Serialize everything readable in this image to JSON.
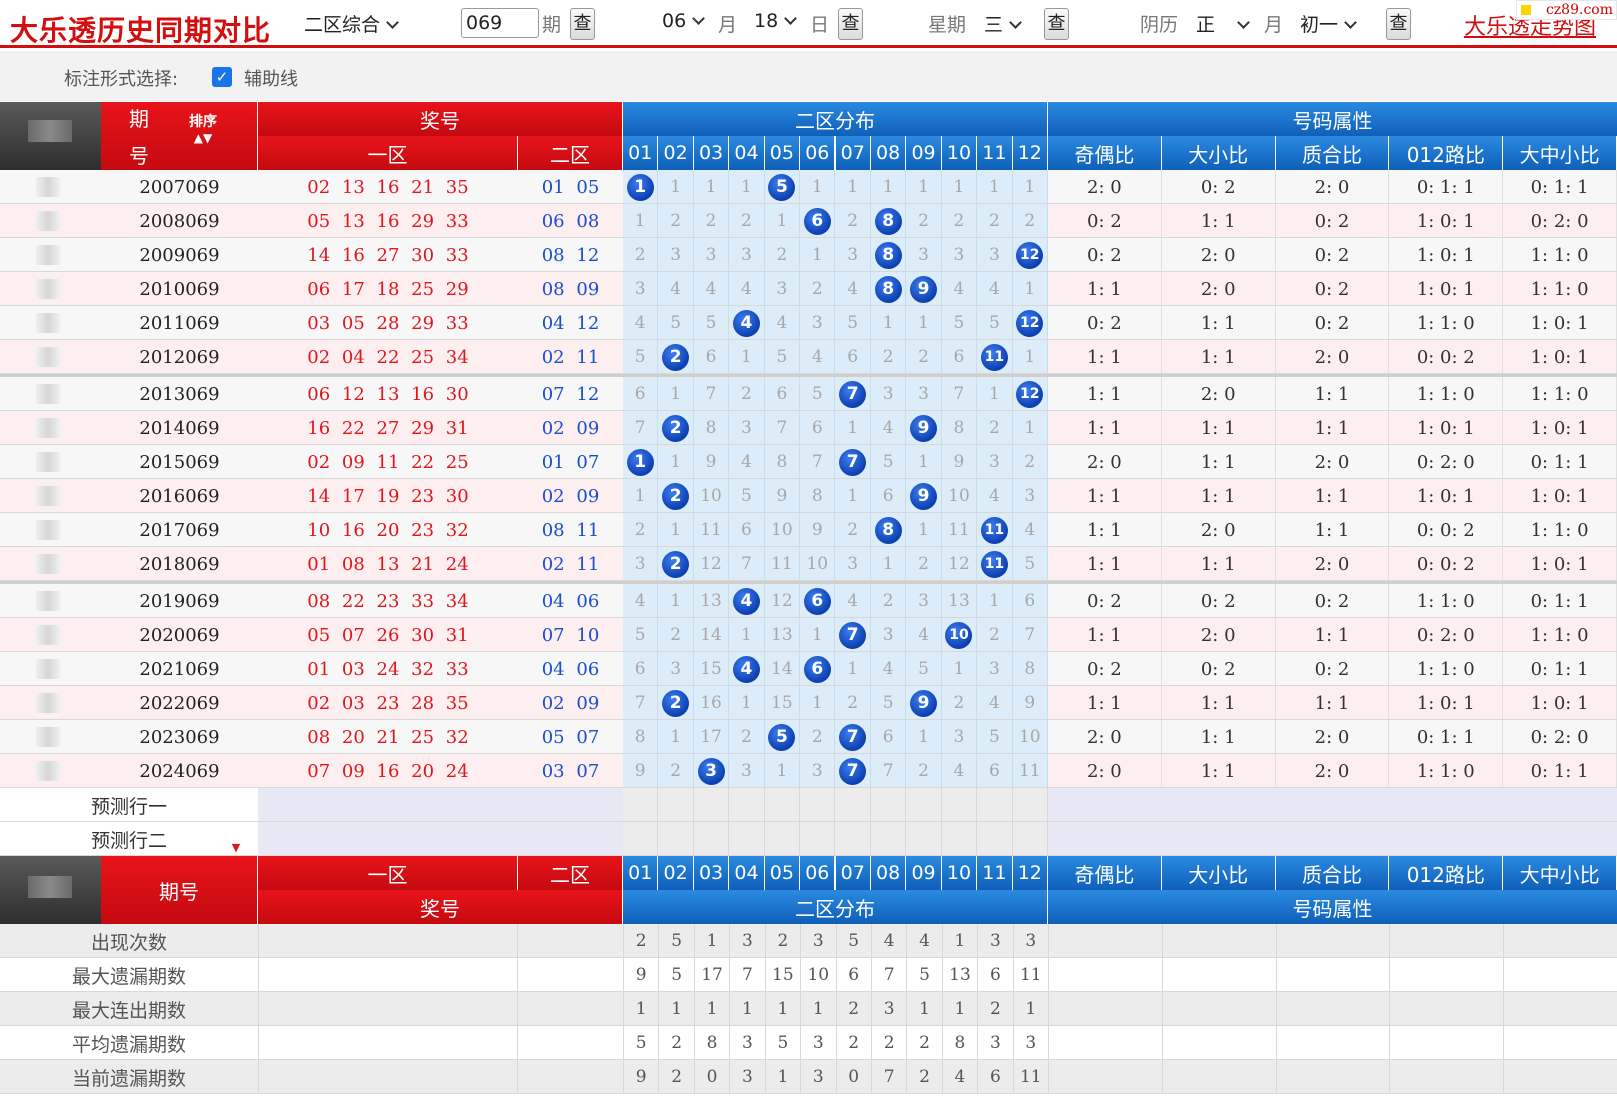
{
  "header": {
    "title": "大乐透历史同期对比",
    "mode_select": "二区综合",
    "issue_input": "069",
    "issue_suffix": "期",
    "query_label": "查",
    "month_select": "06",
    "month_suffix": "月",
    "day_select": "18",
    "day_suffix": "日",
    "weekday_label": "星期",
    "weekday_select": "三",
    "lunar_label": "阴历",
    "lunar_month_select": "正",
    "lunar_month_suffix": "月",
    "lunar_day_select": "初一",
    "trend_link": "大乐透走势图",
    "logo_text": "cz89.com"
  },
  "options": {
    "label": "标注形式选择:",
    "checkbox_label": "辅助线",
    "checkbox_checked": true
  },
  "table": {
    "col_period": "期号",
    "col_period_a": "期",
    "col_period_b": "号",
    "col_sort": "排序",
    "col_prize": "奖号",
    "col_zone1": "一区",
    "col_zone2": "二区",
    "col_dist": "二区分布",
    "col_attr": "号码属性",
    "numbers": [
      "01",
      "02",
      "03",
      "04",
      "05",
      "06",
      "07",
      "08",
      "09",
      "10",
      "11",
      "12"
    ],
    "attr_cols": [
      "奇偶比",
      "大小比",
      "质合比",
      "012路比",
      "大中小比"
    ],
    "rows": [
      {
        "period": "2007069",
        "zone1": "02 13 16 21 35",
        "zone2": "01 05",
        "dist": [
          "●1",
          "1",
          "1",
          "1",
          "●5",
          "1",
          "1",
          "1",
          "1",
          "1",
          "1",
          "1"
        ],
        "attrs": [
          "2: 0",
          "0: 2",
          "2: 0",
          "0: 1: 1",
          "0: 1: 1"
        ]
      },
      {
        "period": "2008069",
        "zone1": "05 13 16 29 33",
        "zone2": "06 08",
        "dist": [
          "1",
          "2",
          "2",
          "2",
          "1",
          "●6",
          "2",
          "●8",
          "2",
          "2",
          "2",
          "2"
        ],
        "attrs": [
          "0: 2",
          "1: 1",
          "0: 2",
          "1: 0: 1",
          "0: 2: 0"
        ]
      },
      {
        "period": "2009069",
        "zone1": "14 16 27 30 33",
        "zone2": "08 12",
        "dist": [
          "2",
          "3",
          "3",
          "3",
          "2",
          "1",
          "3",
          "●8",
          "3",
          "3",
          "3",
          "●12"
        ],
        "attrs": [
          "0: 2",
          "2: 0",
          "0: 2",
          "1: 0: 1",
          "1: 1: 0"
        ]
      },
      {
        "period": "2010069",
        "zone1": "06 17 18 25 29",
        "zone2": "08 09",
        "dist": [
          "3",
          "4",
          "4",
          "4",
          "3",
          "2",
          "4",
          "●8",
          "●9",
          "4",
          "4",
          "1"
        ],
        "attrs": [
          "1: 1",
          "2: 0",
          "0: 2",
          "1: 0: 1",
          "1: 1: 0"
        ]
      },
      {
        "period": "2011069",
        "zone1": "03 05 28 29 33",
        "zone2": "04 12",
        "dist": [
          "4",
          "5",
          "5",
          "●4",
          "4",
          "3",
          "5",
          "1",
          "1",
          "5",
          "5",
          "●12"
        ],
        "attrs": [
          "0: 2",
          "1: 1",
          "0: 2",
          "1: 1: 0",
          "1: 0: 1"
        ]
      },
      {
        "period": "2012069",
        "zone1": "02 04 22 25 34",
        "zone2": "02 11",
        "dist": [
          "5",
          "●2",
          "6",
          "1",
          "5",
          "4",
          "6",
          "2",
          "2",
          "6",
          "●11",
          "1"
        ],
        "attrs": [
          "1: 1",
          "1: 1",
          "2: 0",
          "0: 0: 2",
          "1: 0: 1"
        ]
      },
      {
        "period": "2013069",
        "zone1": "06 12 13 16 30",
        "zone2": "07 12",
        "dist": [
          "6",
          "1",
          "7",
          "2",
          "6",
          "5",
          "●7",
          "3",
          "3",
          "7",
          "1",
          "●12"
        ],
        "attrs": [
          "1: 1",
          "2: 0",
          "1: 1",
          "1: 1: 0",
          "1: 1: 0"
        ]
      },
      {
        "period": "2014069",
        "zone1": "16 22 27 29 31",
        "zone2": "02 09",
        "dist": [
          "7",
          "●2",
          "8",
          "3",
          "7",
          "6",
          "1",
          "4",
          "●9",
          "8",
          "2",
          "1"
        ],
        "attrs": [
          "1: 1",
          "1: 1",
          "1: 1",
          "1: 0: 1",
          "1: 0: 1"
        ]
      },
      {
        "period": "2015069",
        "zone1": "02 09 11 22 25",
        "zone2": "01 07",
        "dist": [
          "●1",
          "1",
          "9",
          "4",
          "8",
          "7",
          "●7",
          "5",
          "1",
          "9",
          "3",
          "2"
        ],
        "attrs": [
          "2: 0",
          "1: 1",
          "2: 0",
          "0: 2: 0",
          "0: 1: 1"
        ]
      },
      {
        "period": "2016069",
        "zone1": "14 17 19 23 30",
        "zone2": "02 09",
        "dist": [
          "1",
          "●2",
          "10",
          "5",
          "9",
          "8",
          "1",
          "6",
          "●9",
          "10",
          "4",
          "3"
        ],
        "attrs": [
          "1: 1",
          "1: 1",
          "1: 1",
          "1: 0: 1",
          "1: 0: 1"
        ]
      },
      {
        "period": "2017069",
        "zone1": "10 16 20 23 32",
        "zone2": "08 11",
        "dist": [
          "2",
          "1",
          "11",
          "6",
          "10",
          "9",
          "2",
          "●8",
          "1",
          "11",
          "●11",
          "4"
        ],
        "attrs": [
          "1: 1",
          "2: 0",
          "1: 1",
          "0: 0: 2",
          "1: 1: 0"
        ]
      },
      {
        "period": "2018069",
        "zone1": "01 08 13 21 24",
        "zone2": "02 11",
        "dist": [
          "3",
          "●2",
          "12",
          "7",
          "11",
          "10",
          "3",
          "1",
          "2",
          "12",
          "●11",
          "5"
        ],
        "attrs": [
          "1: 1",
          "1: 1",
          "2: 0",
          "0: 0: 2",
          "1: 0: 1"
        ]
      },
      {
        "period": "2019069",
        "zone1": "08 22 23 33 34",
        "zone2": "04 06",
        "dist": [
          "4",
          "1",
          "13",
          "●4",
          "12",
          "●6",
          "4",
          "2",
          "3",
          "13",
          "1",
          "6"
        ],
        "attrs": [
          "0: 2",
          "0: 2",
          "0: 2",
          "1: 1: 0",
          "0: 1: 1"
        ]
      },
      {
        "period": "2020069",
        "zone1": "05 07 26 30 31",
        "zone2": "07 10",
        "dist": [
          "5",
          "2",
          "14",
          "1",
          "13",
          "1",
          "●7",
          "3",
          "4",
          "●10",
          "2",
          "7"
        ],
        "attrs": [
          "1: 1",
          "2: 0",
          "1: 1",
          "0: 2: 0",
          "1: 1: 0"
        ]
      },
      {
        "period": "2021069",
        "zone1": "01 03 24 32 33",
        "zone2": "04 06",
        "dist": [
          "6",
          "3",
          "15",
          "●4",
          "14",
          "●6",
          "1",
          "4",
          "5",
          "1",
          "3",
          "8"
        ],
        "attrs": [
          "0: 2",
          "0: 2",
          "0: 2",
          "1: 1: 0",
          "0: 1: 1"
        ]
      },
      {
        "period": "2022069",
        "zone1": "02 03 23 28 35",
        "zone2": "02 09",
        "dist": [
          "7",
          "●2",
          "16",
          "1",
          "15",
          "1",
          "2",
          "5",
          "●9",
          "2",
          "4",
          "9"
        ],
        "attrs": [
          "1: 1",
          "1: 1",
          "1: 1",
          "1: 0: 1",
          "1: 0: 1"
        ]
      },
      {
        "period": "2023069",
        "zone1": "08 20 21 25 32",
        "zone2": "05 07",
        "dist": [
          "8",
          "1",
          "17",
          "2",
          "●5",
          "2",
          "●7",
          "6",
          "1",
          "3",
          "5",
          "10"
        ],
        "attrs": [
          "2: 0",
          "1: 1",
          "2: 0",
          "0: 1: 1",
          "0: 2: 0"
        ]
      },
      {
        "period": "2024069",
        "zone1": "07 09 16 20 24",
        "zone2": "03 07",
        "dist": [
          "9",
          "2",
          "●3",
          "3",
          "1",
          "3",
          "●7",
          "7",
          "2",
          "4",
          "6",
          "11"
        ],
        "attrs": [
          "2: 0",
          "1: 1",
          "2: 0",
          "1: 1: 0",
          "0: 1: 1"
        ]
      }
    ],
    "predict_rows": [
      "预测行一",
      "预测行二"
    ],
    "stats": [
      {
        "label": "出现次数",
        "values": [
          "2",
          "5",
          "1",
          "3",
          "2",
          "3",
          "5",
          "4",
          "4",
          "1",
          "3",
          "3"
        ]
      },
      {
        "label": "最大遗漏期数",
        "values": [
          "9",
          "5",
          "17",
          "7",
          "15",
          "10",
          "6",
          "7",
          "5",
          "13",
          "6",
          "11"
        ]
      },
      {
        "label": "最大连出期数",
        "values": [
          "1",
          "1",
          "1",
          "1",
          "1",
          "1",
          "2",
          "3",
          "1",
          "1",
          "2",
          "1"
        ]
      },
      {
        "label": "平均遗漏期数",
        "values": [
          "5",
          "2",
          "8",
          "3",
          "5",
          "3",
          "2",
          "2",
          "2",
          "8",
          "3",
          "3"
        ]
      },
      {
        "label": "当前遗漏期数",
        "values": [
          "9",
          "2",
          "0",
          "3",
          "1",
          "3",
          "0",
          "7",
          "2",
          "4",
          "6",
          "11"
        ]
      }
    ]
  },
  "colors": {
    "red": "#d40e0e",
    "blue": "#0f5fb8",
    "ball": "#0c3fb0",
    "dist_bg": "#dcecf9",
    "row_alt": "#fdeef0",
    "pred_bg": "#e8e8f4"
  }
}
